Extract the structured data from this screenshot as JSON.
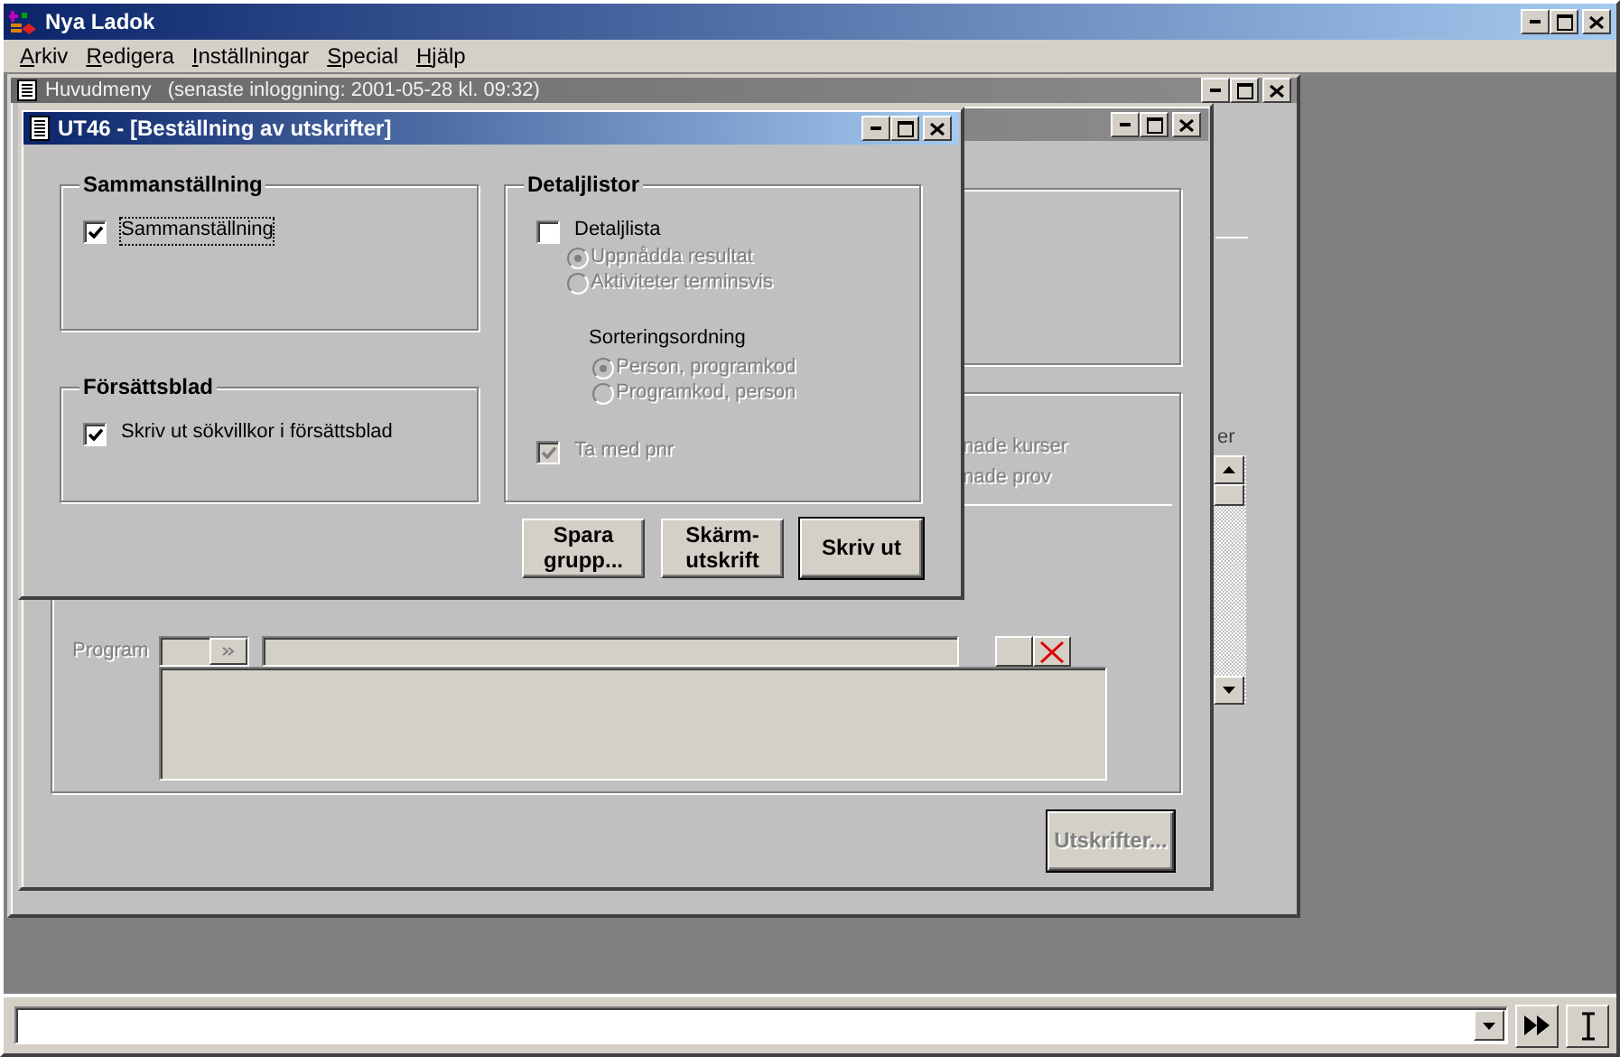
{
  "app": {
    "title": "Nya Ladok",
    "active": true
  },
  "menu": [
    {
      "label": "Arkiv"
    },
    {
      "label": "Redigera"
    },
    {
      "label": "Inställningar"
    },
    {
      "label": "Special"
    },
    {
      "label": "Hjälp"
    }
  ],
  "main_window": {
    "title": "Huvudmeny   (senaste inloggning: 2001-05-28 kl. 09:32)",
    "active": false,
    "fragment": "er"
  },
  "second_window": {
    "active": false,
    "lines": [
      "nade kurser",
      "nade prov"
    ],
    "program_label": "Program",
    "print_button": {
      "label": "Utskrifter...",
      "disabled": true
    }
  },
  "dialog": {
    "title": "UT46 - [Beställning av utskrifter]",
    "active": true,
    "groups": [
      {
        "title": "Sammanställning",
        "items": [
          {
            "kind": "checkbox",
            "label": "Sammanställning",
            "checked": true,
            "disabled": false,
            "focused": true
          }
        ]
      },
      {
        "title": "Försättsblad",
        "items": [
          {
            "kind": "checkbox",
            "label": "Skriv ut sökvillkor i försättsblad",
            "checked": true,
            "disabled": false,
            "focused": false
          }
        ]
      },
      {
        "title": "Detaljlistor",
        "items": [
          {
            "kind": "checkbox",
            "label": "Detaljlista",
            "checked": false,
            "disabled": false,
            "focused": false,
            "options": [
              {
                "label": "Uppnådda resultat",
                "selected": true,
                "disabled": true
              },
              {
                "label": "Aktiviteter terminsvis",
                "selected": false,
                "disabled": true
              }
            ]
          },
          {
            "kind": "heading",
            "label": "Sorteringsordning",
            "options": [
              {
                "label": "Person, programkod",
                "selected": true,
                "disabled": true
              },
              {
                "label": "Programkod, person",
                "selected": false,
                "disabled": true
              }
            ]
          },
          {
            "kind": "checkbox",
            "label": "Ta med pnr",
            "checked": true,
            "disabled": true,
            "focused": false
          }
        ]
      }
    ],
    "buttons": [
      {
        "label": "Spara grupp...",
        "default": false
      },
      {
        "label": "Skärm-utskrift",
        "default": false
      },
      {
        "label": "Skriv ut",
        "default": true
      }
    ]
  },
  "command_bar": {
    "buttons": [
      {
        "kind": "run"
      },
      {
        "kind": "cursor"
      }
    ]
  }
}
